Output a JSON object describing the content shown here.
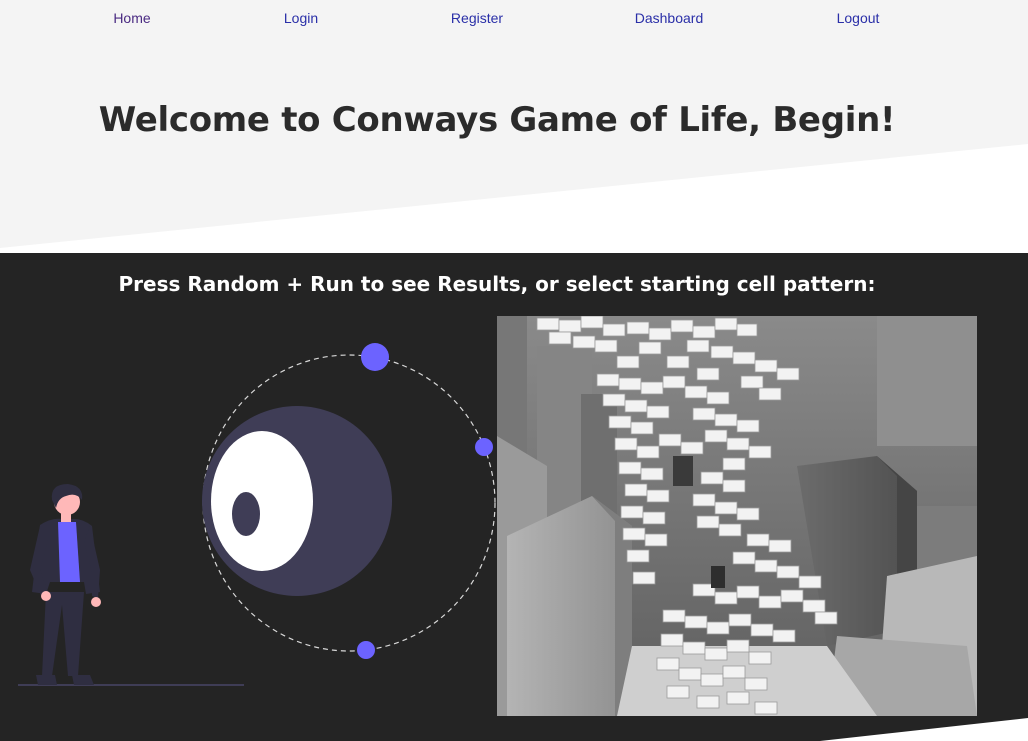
{
  "nav": {
    "home": "Home",
    "login": "Login",
    "register": "Register",
    "dashboard": "Dashboard",
    "logout": "Logout"
  },
  "hero": {
    "title": "Welcome to Conways Game of Life, Begin!"
  },
  "main": {
    "instructions": "Press Random + Run to see Results, or select starting cell pattern:"
  },
  "colors": {
    "accent": "#6c63ff",
    "dark_bg": "#242424",
    "light_bg": "#f4f4f4",
    "link": "#2a2fa8",
    "planet": "#3f3d56"
  }
}
